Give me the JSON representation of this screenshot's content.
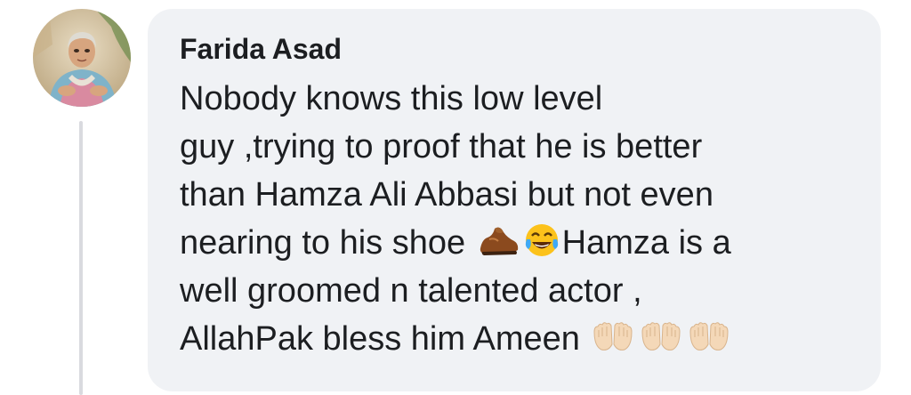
{
  "comment": {
    "author": "Farida Asad",
    "avatar_icon": "profile-photo",
    "lines": [
      "Nobody knows this low level",
      "guy ,trying to proof that he is better",
      "than Hamza Ali Abbasi but not even"
    ],
    "line4_text_a": "nearing to his shoe",
    "line4_text_b": "Hamza is a",
    "line5": "well groomed n talented actor ,",
    "line6": "AllahPak bless him Ameen",
    "emoji_icons": [
      "shoe-emoji",
      "tears-of-joy-emoji",
      "palms-up-together-emoji"
    ]
  },
  "colors": {
    "bubble_bg": "#f0f2f5",
    "text": "#1c1e21",
    "thread_line": "#d9dadf"
  }
}
